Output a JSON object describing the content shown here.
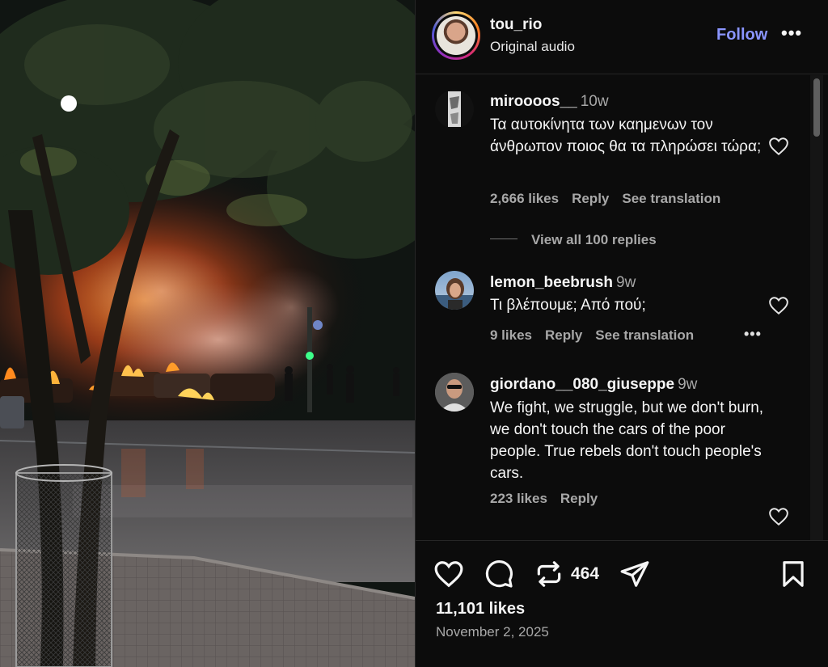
{
  "post": {
    "username": "tou_rio",
    "audio": "Original audio",
    "follow_label": "Follow",
    "more_label": "•••"
  },
  "comments": [
    {
      "username": "miroooos__",
      "time": "10w",
      "text": "Τα αυτοκίνητα των καημενων τον άνθρωπον ποιος θα τα πληρώσει τώρα;",
      "likes": "2,666 likes",
      "reply_label": "Reply",
      "translation_label": "See translation",
      "view_replies": "View all 100 replies"
    },
    {
      "username": "lemon_beebrush",
      "time": "9w",
      "text": "Τι βλέπουμε; Από πού;",
      "likes": "9 likes",
      "reply_label": "Reply",
      "translation_label": "See translation",
      "more_label": "•••"
    },
    {
      "username": "giordano__080_giuseppe",
      "time": "9w",
      "text": "We fight, we struggle, but we don't burn, we don't touch the cars of the poor people. True rebels don't touch people's cars.",
      "likes": "223 likes",
      "reply_label": "Reply"
    }
  ],
  "actions": {
    "repost_count": "464",
    "icons": [
      "heart-icon",
      "comment-icon",
      "repost-icon",
      "share-icon",
      "bookmark-icon"
    ]
  },
  "likes_text": "11,101 likes",
  "date_text": "November 2, 2025",
  "colors": {
    "follow": "#8a95ff",
    "muted": "#a8a8a8",
    "background": "#0c0c0c",
    "fire": "#ff7a1a"
  }
}
